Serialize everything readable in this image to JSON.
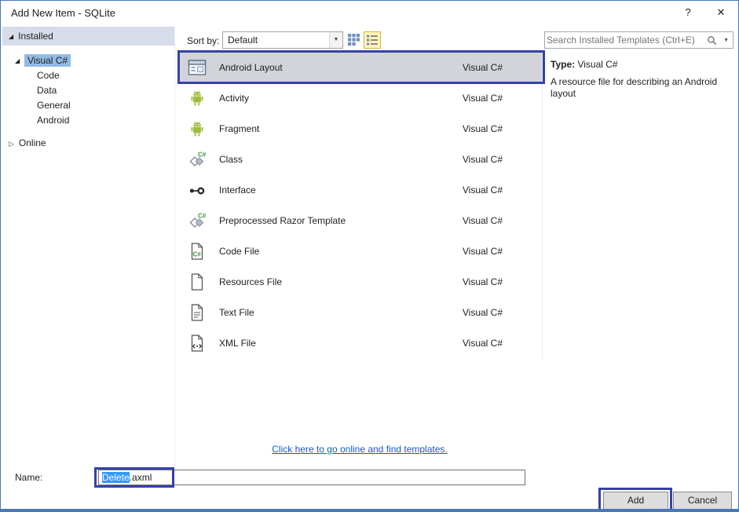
{
  "colors": {
    "window-border": "#4579b8",
    "annotation": "#3542a8",
    "selection-blue": "#3399ff",
    "tree-selection": "#92bbe4",
    "installed-header-bg": "#d6dce9",
    "selected-row-bg": "#d2d4d9",
    "link-blue": "#0e5fbe",
    "view-toggle-active-bg": "#fdf4bd",
    "view-toggle-active-border": "#d9b23c"
  },
  "window": {
    "title": "Add New Item - SQLite",
    "help_glyph": "?",
    "close_glyph": "✕"
  },
  "left_panel": {
    "installed_label": "Installed",
    "online_label": "Online",
    "expanded_glyph": "◢",
    "collapsed_glyph": "▷",
    "tree": [
      {
        "label": "Visual C#",
        "level": 0,
        "expanded": true,
        "selected": true
      },
      {
        "label": "Code",
        "level": 1
      },
      {
        "label": "Data",
        "level": 1
      },
      {
        "label": "General",
        "level": 1
      },
      {
        "label": "Android",
        "level": 1
      }
    ]
  },
  "toolbar": {
    "sort_label": "Sort by:",
    "sort_value": "Default",
    "dropdown_glyph": "▼"
  },
  "search": {
    "placeholder": "Search Installed Templates (Ctrl+E)",
    "dropdown_glyph": "▼"
  },
  "templates": [
    {
      "name": "Android Layout",
      "type": "Visual C#",
      "icon": "layout",
      "selected": true
    },
    {
      "name": "Activity",
      "type": "Visual C#",
      "icon": "android"
    },
    {
      "name": "Fragment",
      "type": "Visual C#",
      "icon": "android"
    },
    {
      "name": "Class",
      "type": "Visual C#",
      "icon": "class"
    },
    {
      "name": "Interface",
      "type": "Visual C#",
      "icon": "interface"
    },
    {
      "name": "Preprocessed Razor Template",
      "type": "Visual C#",
      "icon": "razor"
    },
    {
      "name": "Code File",
      "type": "Visual C#",
      "icon": "codefile"
    },
    {
      "name": "Resources File",
      "type": "Visual C#",
      "icon": "file"
    },
    {
      "name": "Text File",
      "type": "Visual C#",
      "icon": "textfile"
    },
    {
      "name": "XML File",
      "type": "Visual C#",
      "icon": "xmlfile"
    }
  ],
  "online_link": "Click here to go online and find templates.",
  "info_panel": {
    "type_label": "Type:",
    "type_value": "Visual C#",
    "description": "A resource file for describing an Android layout"
  },
  "footer": {
    "name_label": "Name:",
    "name_selected_text": "Delete",
    "name_rest_text": ".axml",
    "add_label": "Add",
    "cancel_label": "Cancel"
  }
}
